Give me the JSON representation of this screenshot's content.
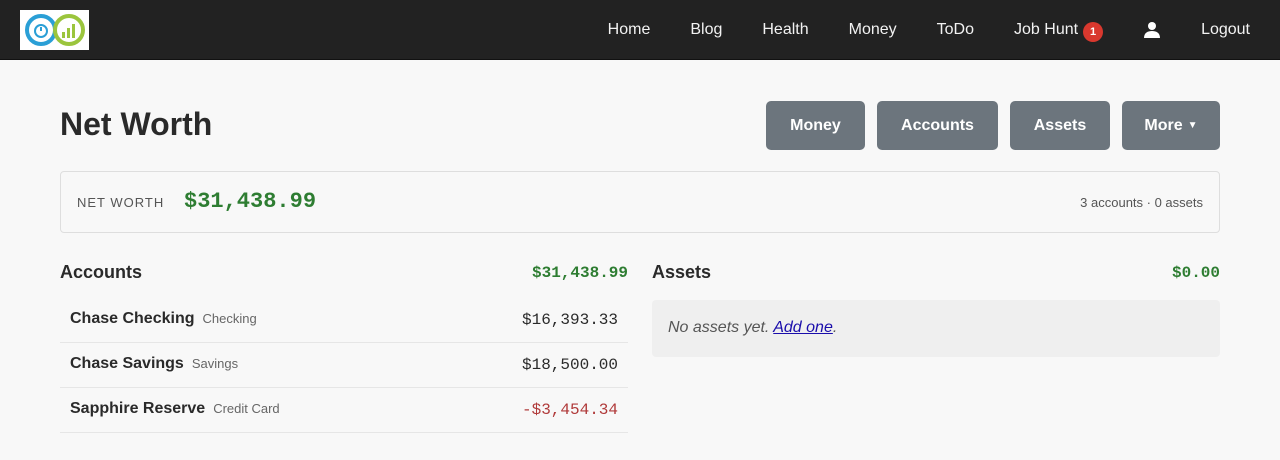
{
  "nav": {
    "items": [
      {
        "label": "Home"
      },
      {
        "label": "Blog"
      },
      {
        "label": "Health"
      },
      {
        "label": "Money"
      },
      {
        "label": "ToDo"
      },
      {
        "label": "Job Hunt",
        "badge": "1"
      }
    ],
    "user_icon": "user-icon",
    "logout_label": "Logout"
  },
  "page": {
    "title": "Net Worth",
    "buttons": {
      "money": "Money",
      "accounts": "Accounts",
      "assets": "Assets",
      "more": "More"
    }
  },
  "summary": {
    "label": "NET WORTH",
    "value": "$31,438.99",
    "meta": "3 accounts · 0 assets"
  },
  "accounts": {
    "title": "Accounts",
    "total": "$31,438.99",
    "rows": [
      {
        "name": "Chase Checking",
        "type": "Checking",
        "amount": "$16,393.33"
      },
      {
        "name": "Chase Savings",
        "type": "Savings",
        "amount": "$18,500.00"
      },
      {
        "name": "Sapphire Reserve",
        "type": "Credit Card",
        "amount": "-$3,454.34"
      }
    ]
  },
  "assets": {
    "title": "Assets",
    "total": "$0.00",
    "empty_text": "No assets yet. ",
    "add_link": "Add one",
    "empty_suffix": "."
  },
  "colors": {
    "topbar": "#222222",
    "button": "#6c757d",
    "positive": "#2e7d32",
    "negative": "#b03a3a",
    "badge": "#d9382e"
  }
}
